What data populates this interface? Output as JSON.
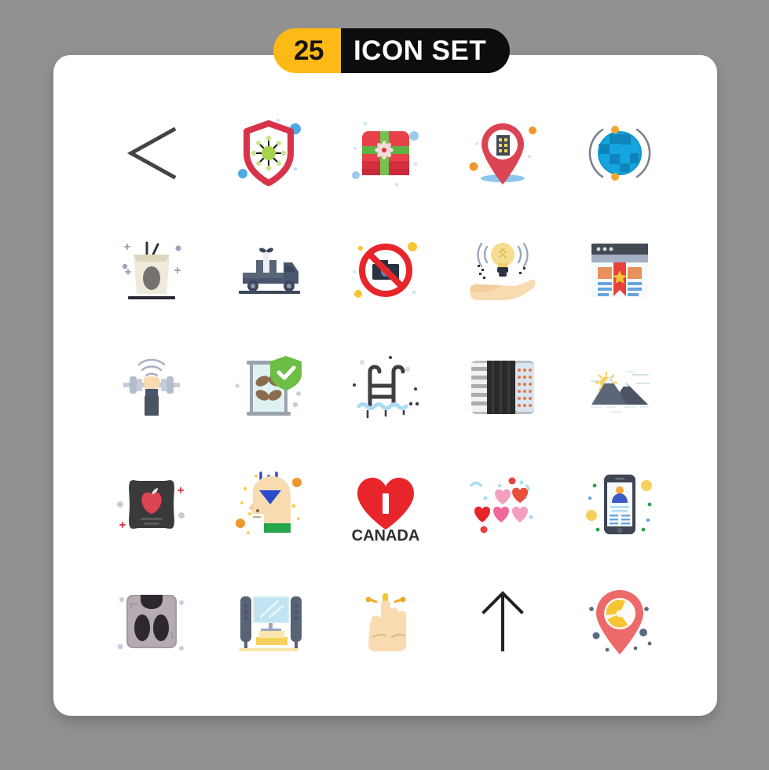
{
  "header": {
    "count": "25",
    "title": "ICON SET",
    "badge_yellow": "#FDBA17",
    "badge_black": "#0d0d0d"
  },
  "page": {
    "background_color": "#919191",
    "card_color": "#ffffff"
  },
  "grid": {
    "columns": 5,
    "rows": 5,
    "total": 25,
    "icons": [
      {
        "name": "chevron-left-icon",
        "label": "Back arrow",
        "color": "#444444"
      },
      {
        "name": "virus-shield-icon",
        "label": "Virus protection",
        "color": "#D8334A"
      },
      {
        "name": "gift-box-icon",
        "label": "Gift box",
        "color": "#D8334A"
      },
      {
        "name": "location-building-icon",
        "label": "Building location pin",
        "color": "#D8334A"
      },
      {
        "name": "globe-orbit-icon",
        "label": "Global network",
        "color": "#0C9FDC"
      },
      {
        "name": "noodle-box-icon",
        "label": "Takeaway noodles",
        "color": "#EDE8D6"
      },
      {
        "name": "gift-delivery-truck-icon",
        "label": "Gift delivery truck",
        "color": "#49566F"
      },
      {
        "name": "no-photo-icon",
        "label": "No photography",
        "color": "#E8252A"
      },
      {
        "name": "idea-in-hand-icon",
        "label": "Idea in hand",
        "color": "#F6D276"
      },
      {
        "name": "bookmark-page-icon",
        "label": "Bookmarked web page",
        "color": "#E8413C"
      },
      {
        "name": "weight-lifting-icon",
        "label": "Weight lifting",
        "color": "#C6CBD9"
      },
      {
        "name": "hourglass-shield-icon",
        "label": "Secure time",
        "color": "#6DBE45"
      },
      {
        "name": "pool-ladder-icon",
        "label": "Swimming pool",
        "color": "#3F3F3F"
      },
      {
        "name": "accordion-icon",
        "label": "Accordion",
        "color": "#2B2B2B"
      },
      {
        "name": "mountain-sun-icon",
        "label": "Mountains",
        "color": "#5D6579"
      },
      {
        "name": "apple-bag-icon",
        "label": "Apple bag",
        "color": "#3A3A3A"
      },
      {
        "name": "knowledge-head-icon",
        "label": "Input knowledge",
        "color": "#F6D4A8"
      },
      {
        "name": "i-love-canada-icon",
        "label": "I CANADA",
        "color": "#E8252A"
      },
      {
        "name": "hearts-confetti-icon",
        "label": "Hearts",
        "color": "#F0679A"
      },
      {
        "name": "mobile-profile-icon",
        "label": "Mobile user profile",
        "color": "#3E4553"
      },
      {
        "name": "weight-scale-icon",
        "label": "Weighing scale",
        "color": "#9C9399"
      },
      {
        "name": "home-theater-icon",
        "label": "Home theater",
        "color": "#5A6276"
      },
      {
        "name": "tap-gesture-icon",
        "label": "Tap gesture",
        "color": "#F6D4A8"
      },
      {
        "name": "arrow-up-icon",
        "label": "Up arrow",
        "color": "#222222"
      },
      {
        "name": "radiation-location-icon",
        "label": "Radiation zone",
        "color": "#EE6A6A"
      }
    ],
    "heart_text": "CANADA",
    "heart_letter": "I"
  }
}
